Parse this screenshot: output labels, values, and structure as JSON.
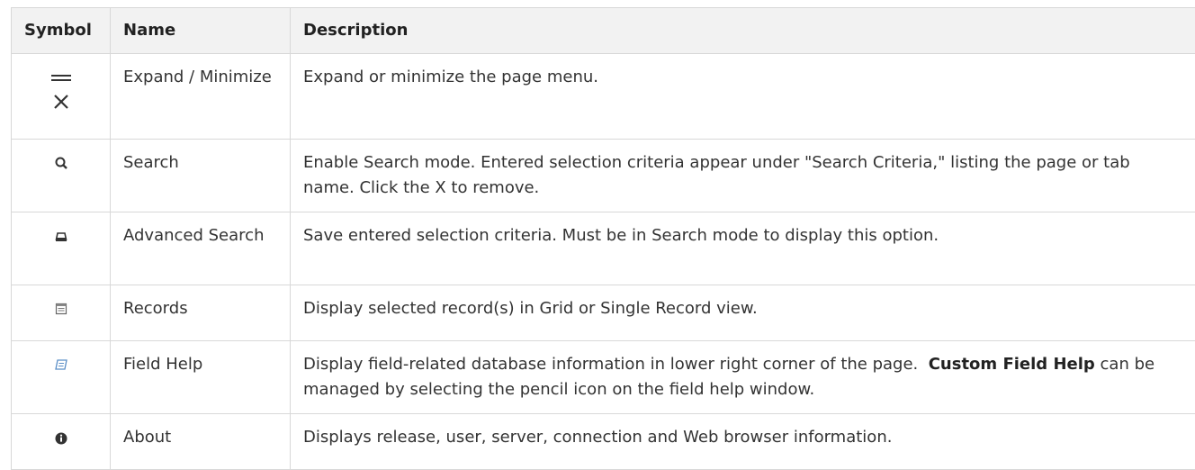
{
  "table": {
    "headers": [
      "Symbol",
      "Name",
      "Description"
    ],
    "rows": [
      {
        "icon": "menu-close-icon",
        "name": "Expand / Minimize",
        "description": "Expand or minimize the page menu."
      },
      {
        "icon": "search-icon",
        "name": "Search",
        "description": "Enable Search mode. Entered selection criteria appear under \"Search Criteria,\" listing the page or tab name. Click the X to remove."
      },
      {
        "icon": "inbox-icon",
        "name": "Advanced Search",
        "description": "Save entered selection criteria. Must be in Search mode to display this option."
      },
      {
        "icon": "records-icon",
        "name": "Records",
        "description": "Display selected record(s) in Grid or Single Record view."
      },
      {
        "icon": "field-help-icon",
        "name": "Field Help",
        "description_before": "Display field-related database information in lower right corner of the page.",
        "description_bold": "Custom Field Help",
        "description_after": "can be managed by selecting the pencil icon on the field help window."
      },
      {
        "icon": "info-icon",
        "name": "About",
        "description": "Displays release, user, server, connection and Web browser information."
      }
    ]
  }
}
